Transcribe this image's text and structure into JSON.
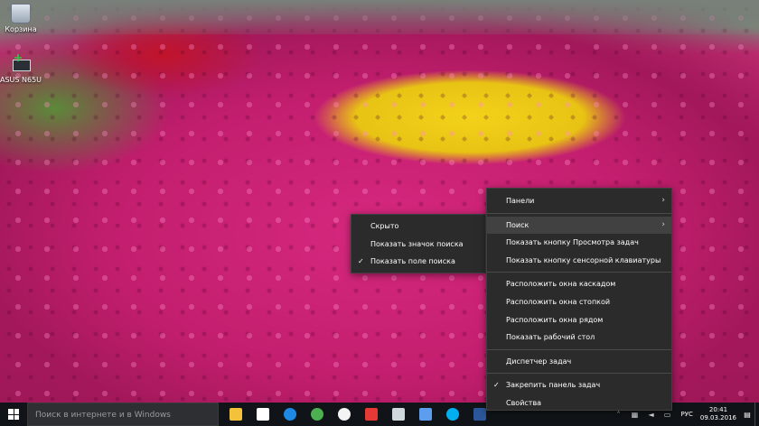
{
  "desktop": {
    "icons": [
      {
        "label": "Корзина"
      },
      {
        "label": "ASUS N65U"
      }
    ]
  },
  "main_menu": {
    "items": [
      {
        "label": "Панели",
        "submenu": true
      },
      {
        "label": "Поиск",
        "submenu": true,
        "hovered": true
      },
      {
        "label": "Показать кнопку Просмотра задач"
      },
      {
        "label": "Показать кнопку сенсорной клавиатуры"
      },
      {
        "label": "Расположить окна каскадом"
      },
      {
        "label": "Расположить окна стопкой"
      },
      {
        "label": "Расположить окна рядом"
      },
      {
        "label": "Показать рабочий стол"
      },
      {
        "label": "Диспетчер задач"
      },
      {
        "label": "Закрепить панель задач",
        "checked": true
      },
      {
        "label": "Свойства"
      }
    ]
  },
  "sub_menu": {
    "items": [
      {
        "label": "Скрыто"
      },
      {
        "label": "Показать значок поиска"
      },
      {
        "label": "Показать поле поиска",
        "checked": true
      }
    ]
  },
  "taskbar": {
    "search_placeholder": "Поиск в интернете и в Windows",
    "apps": [
      {
        "icon": "file-explorer-icon",
        "color": "#f3c13a"
      },
      {
        "icon": "store-icon",
        "color": "#ffffff"
      },
      {
        "icon": "edge-icon",
        "color": "#1e88e5"
      },
      {
        "icon": "chrome-icon",
        "color": "#4caf50"
      },
      {
        "icon": "yandex-browser-icon",
        "color": "#f4f4f4"
      },
      {
        "icon": "ccleaner-icon",
        "color": "#e53935"
      },
      {
        "icon": "screenshot-tool-icon",
        "color": "#cfd8dc"
      },
      {
        "icon": "control-panel-icon",
        "color": "#5c9ded"
      },
      {
        "icon": "skype-icon",
        "color": "#00aff0"
      },
      {
        "icon": "word-icon",
        "color": "#2b579a"
      }
    ],
    "tray": {
      "language": "РУС",
      "time": "20:41",
      "date": "09.03.2016"
    }
  }
}
